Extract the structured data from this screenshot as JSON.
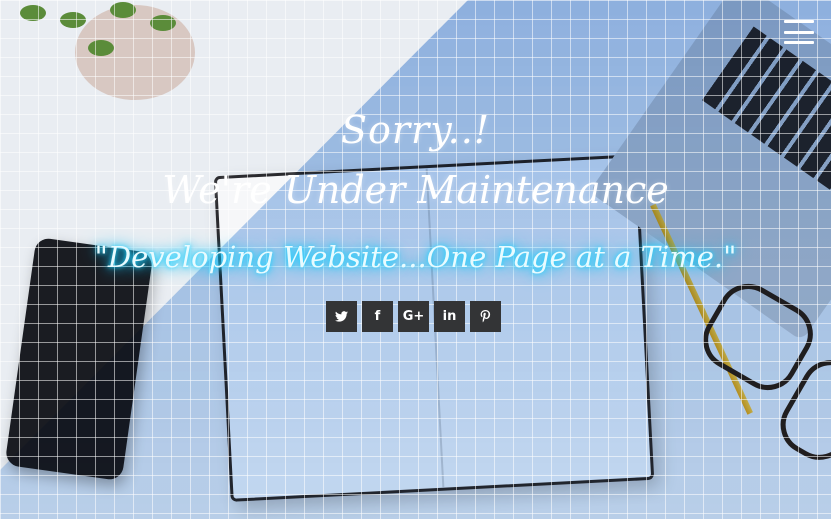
{
  "heading": {
    "line1": "Sorry..!",
    "line2": "We're Under Maintenance"
  },
  "tagline": "\"Developing Website...One Page at a Time.\"",
  "menu": {
    "icon": "hamburger-menu-icon"
  },
  "social": [
    {
      "name": "twitter-icon",
      "glyph": "🐦",
      "label": "t"
    },
    {
      "name": "facebook-icon",
      "glyph": "f",
      "label": "f"
    },
    {
      "name": "google-plus-icon",
      "glyph": "G+",
      "label": "G+"
    },
    {
      "name": "linkedin-icon",
      "glyph": "in",
      "label": "in"
    },
    {
      "name": "pinterest-icon",
      "glyph": "P",
      "label": "P"
    }
  ],
  "colors": {
    "tagline_glow": "#22d6ff",
    "social_bg": "#333436",
    "band": "#5892dc"
  }
}
